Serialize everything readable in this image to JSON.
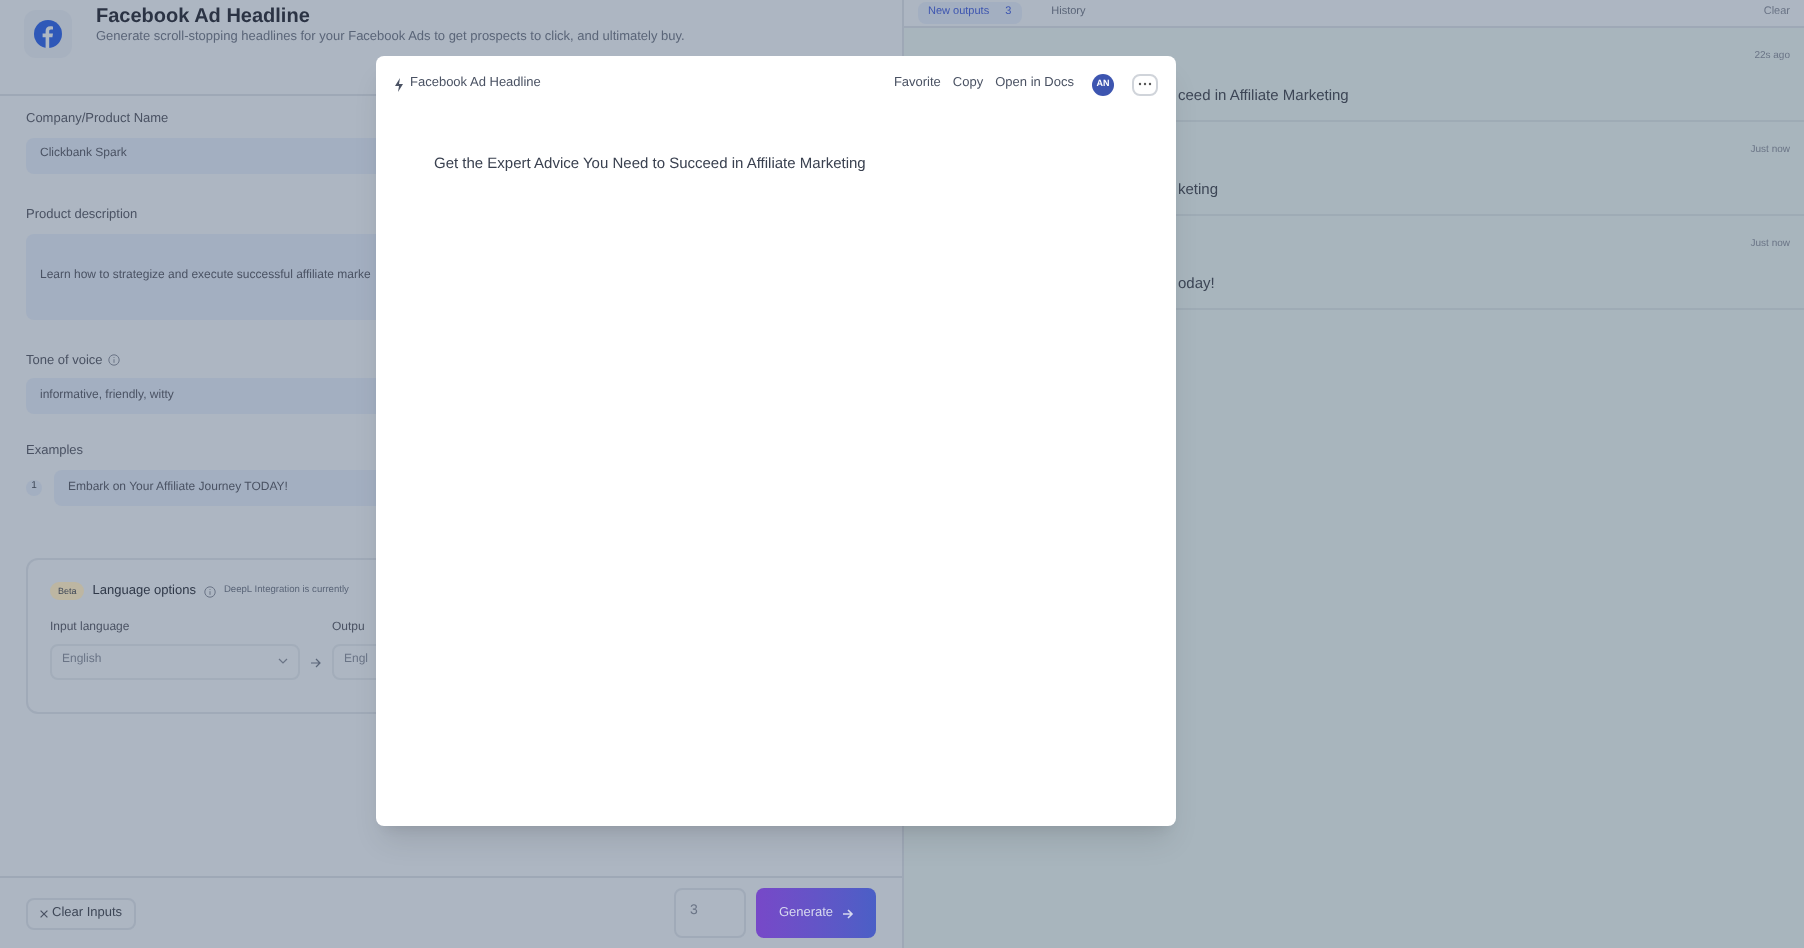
{
  "header": {
    "title": "Facebook Ad Headline",
    "subtitle": "Generate scroll-stopping headlines for your Facebook Ads to get prospects to click, and ultimately buy."
  },
  "form": {
    "fields": [
      {
        "kind": "input",
        "label": "Company/Product Name",
        "value": "Clickbank Spark",
        "info": false
      },
      {
        "kind": "textarea",
        "label": "Product description",
        "value": "Learn how to strategize and execute successful affiliate marke",
        "info": false
      },
      {
        "kind": "input",
        "label": "Tone of voice",
        "value": "informative, friendly, witty",
        "info": true
      }
    ],
    "examples": {
      "label": "Examples",
      "items": [
        {
          "number": "1",
          "value": "Embark on Your Affiliate Journey TODAY!"
        }
      ]
    }
  },
  "language_options": {
    "badge": "Beta",
    "title": "Language options",
    "note": "DeepL Integration is currently",
    "input_label": "Input language",
    "input_value": "English",
    "output_label": "Outpu",
    "output_value": "Engl"
  },
  "footer": {
    "clear": "Clear Inputs",
    "count": "3",
    "generate": "Generate"
  },
  "outputs": {
    "tabs": [
      {
        "label": "New outputs",
        "count": "3",
        "selected": true
      },
      {
        "label": "History",
        "selected": false
      }
    ],
    "clear": "Clear",
    "rows": [
      {
        "time": "22s ago",
        "text": "ceed in Affiliate Marketing"
      },
      {
        "time": "Just now",
        "text": "keting"
      },
      {
        "time": "Just now",
        "text": "oday!"
      }
    ]
  },
  "modal": {
    "title": "Facebook Ad Headline",
    "actions": [
      "Favorite",
      "Copy",
      "Open in Docs"
    ],
    "avatar": "AN",
    "body": "Get the Expert Advice You Need to Succeed in Affiliate Marketing"
  }
}
